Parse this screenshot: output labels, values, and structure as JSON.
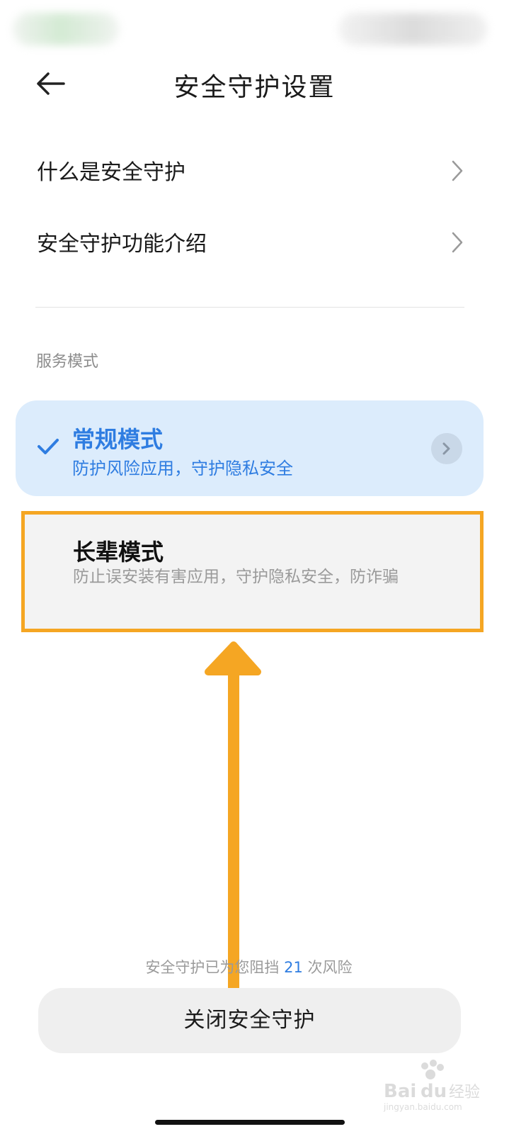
{
  "header": {
    "title": "安全守护设置",
    "back_icon": "arrow-left-icon"
  },
  "menu": {
    "items": [
      {
        "label": "什么是安全守护"
      },
      {
        "label": "安全守护功能介绍"
      }
    ]
  },
  "service_mode": {
    "section_label": "服务模式",
    "normal": {
      "title": "常规模式",
      "description": "防护风险应用，守护隐私安全",
      "selected": true
    },
    "elder": {
      "title": "长辈模式",
      "description": "防止误安装有害应用，守护隐私安全，防诈骗",
      "selected": false
    }
  },
  "footer": {
    "stats_prefix": "安全守护已为您阻挡 ",
    "stats_count": "21",
    "stats_suffix": " 次风险",
    "close_button": "关闭安全守护"
  },
  "colors": {
    "accent": "#2f7de1",
    "highlight": "#f5a623",
    "selected_card_bg": "#dcecfc"
  },
  "watermark": {
    "brand": "Baidu经验",
    "url": "jingyan.baidu.com"
  }
}
